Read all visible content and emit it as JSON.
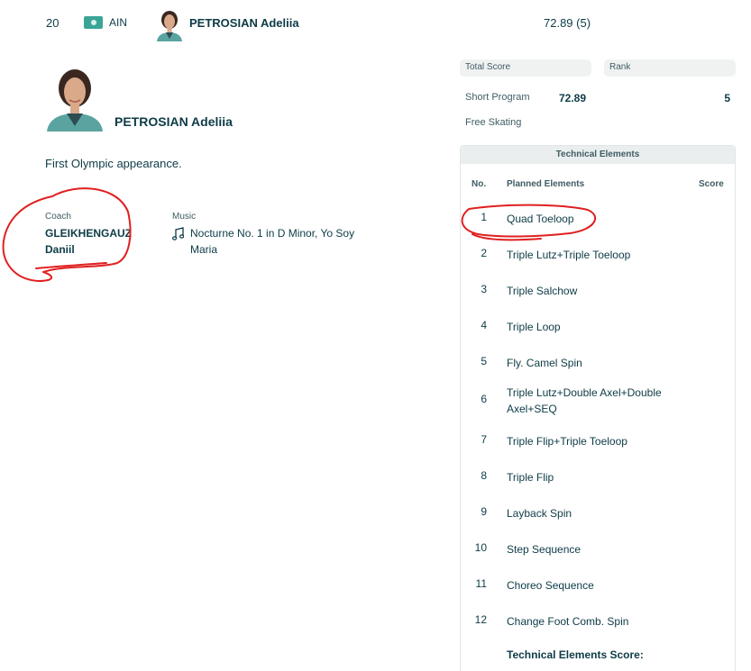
{
  "top_row": {
    "rank": "20",
    "noc": "AIN",
    "name": "PETROSIAN Adeliia",
    "score": "72.89 (5)"
  },
  "athlete": {
    "name": "PETROSIAN Adeliia",
    "note": "First Olympic appearance.",
    "coach_label": "Coach",
    "coach_line1": "GLEIKHENGAUZ",
    "coach_line2": "Daniil",
    "music_label": "Music",
    "music_title": "Nocturne No. 1 in D Minor, Yo Soy Maria",
    "music_icon": "music-note-icon"
  },
  "scores": {
    "total_label": "Total Score",
    "rank_label": "Rank",
    "short_program_label": "Short Program",
    "short_program_score": "72.89",
    "short_program_rank": "5",
    "free_skating_label": "Free Skating"
  },
  "technical_elements": {
    "title": "Technical Elements",
    "col_no": "No.",
    "col_planned": "Planned Elements",
    "col_score": "Score",
    "rows": [
      {
        "no": "1",
        "element": "Quad Toeloop"
      },
      {
        "no": "2",
        "element": "Triple Lutz+Triple Toeloop"
      },
      {
        "no": "3",
        "element": "Triple Salchow"
      },
      {
        "no": "4",
        "element": "Triple Loop"
      },
      {
        "no": "5",
        "element": "Fly. Camel Spin"
      },
      {
        "no": "6",
        "element": "Triple Lutz+Double Axel+Double Axel+SEQ"
      },
      {
        "no": "7",
        "element": "Triple Flip+Triple Toeloop"
      },
      {
        "no": "8",
        "element": "Triple Flip"
      },
      {
        "no": "9",
        "element": "Layback Spin"
      },
      {
        "no": "10",
        "element": "Step Sequence"
      },
      {
        "no": "11",
        "element": "Choreo Sequence"
      },
      {
        "no": "12",
        "element": "Change Foot Comb. Spin"
      }
    ],
    "total_label": "Technical Elements Score:"
  },
  "colors": {
    "text": "#0d3b46",
    "muted": "#3f5c64",
    "flag": "#3aa597",
    "annotation": "#e02020",
    "panel_bg": "#f0f2f2"
  }
}
